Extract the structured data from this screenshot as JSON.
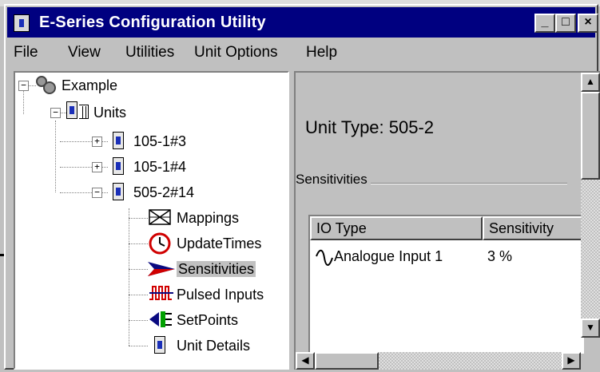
{
  "window": {
    "title": "E-Series Configuration Utility",
    "controls": {
      "minimize": "_",
      "maximize": "□",
      "close": "×"
    }
  },
  "menu": {
    "file": "File",
    "view": "View",
    "utilities": "Utilities",
    "unit_options": "Unit Options",
    "help": "Help"
  },
  "tree": {
    "root": "Example",
    "units": "Units",
    "unit_items": [
      "105-1#3",
      "105-1#4",
      "505-2#14"
    ],
    "children": {
      "mappings": "Mappings",
      "update_times": "UpdateTimes",
      "sensitivities": "Sensitivities",
      "pulsed_inputs": "Pulsed Inputs",
      "set_points": "SetPoints",
      "unit_details": "Unit Details"
    },
    "selected": "Sensitivities"
  },
  "detail": {
    "unit_type": "Unit Type: 505-2",
    "group_label": "Sensitivities",
    "columns": [
      "IO Type",
      "Sensitivity"
    ],
    "rows": [
      {
        "io_type": "Analogue Input 1",
        "sensitivity": "3 %"
      }
    ]
  },
  "colors": {
    "titlebar": "#000080",
    "face": "#c0c0c0",
    "unit_icon_blue": "#1a2fb8"
  }
}
